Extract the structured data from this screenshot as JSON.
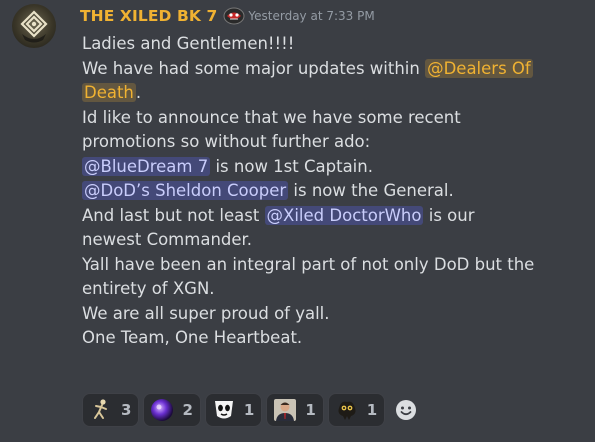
{
  "message": {
    "author": "THE XILED BK 7",
    "timestamp": "Yesterday at 7:33 PM",
    "lines": {
      "l1": "Ladies and Gentlemen!!!!",
      "l2a": "We have had some major updates within ",
      "l2m": "@Dealers Of",
      "l3m": "Death",
      "l3b": ".",
      "l4": "Id like to announce that we have some recent",
      "l5": "promotions so without further ado:",
      "l6m": "@BlueDream 7",
      "l6b": " is now 1st Captain.",
      "l7m": "@DoD’s Sheldon Cooper",
      "l7b": " is now the General.",
      "l8a": "And last but not least ",
      "l8m": "@Xiled DoctorWho",
      "l8b": " is our",
      "l9": "newest Commander.",
      "l10": "Yall have been an integral part of not only DoD but the",
      "l11": "entirety of XGN.",
      "l12": "We are all super proud of yall.",
      "l13": "One Team, One Heartbeat."
    }
  },
  "reactions": [
    {
      "emoji": "dancing-figure-emoji",
      "count": "3"
    },
    {
      "emoji": "purple-orb-emoji",
      "count": "2"
    },
    {
      "emoji": "ghost-face-emoji",
      "count": "1"
    },
    {
      "emoji": "suited-man-emoji",
      "count": "1"
    },
    {
      "emoji": "dark-creature-emoji",
      "count": "1"
    }
  ],
  "colors": {
    "background": "#3b3e44",
    "username": "#f0b232",
    "mention": "#c9cdfb",
    "role_mention": "#f0b232",
    "text": "#dbdee1",
    "timestamp": "#949ba4"
  }
}
